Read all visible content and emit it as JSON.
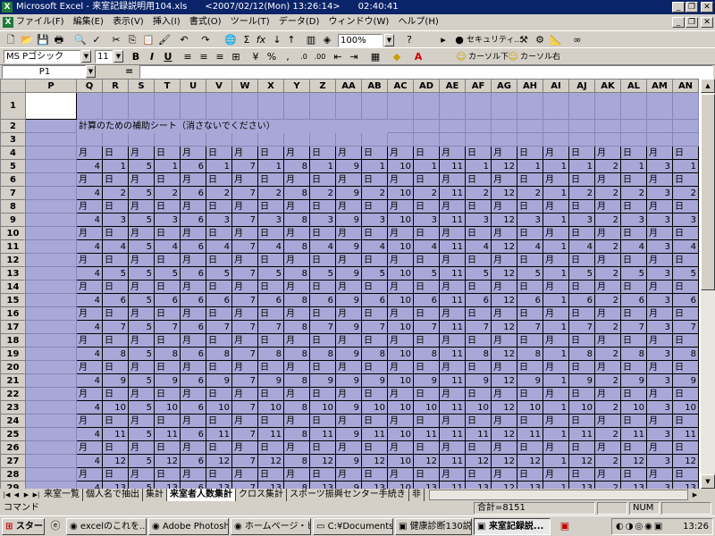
{
  "window": {
    "title": "Microsoft Excel - 来室記録説明用104.xls　　<2007/02/12(Mon) 13:26:14>　　02:40:41",
    "minimize": "_",
    "restore": "❐",
    "close": "✕"
  },
  "menu": [
    "ファイル(F)",
    "編集(E)",
    "表示(V)",
    "挿入(I)",
    "書式(O)",
    "ツール(T)",
    "データ(D)",
    "ウィンドウ(W)",
    "ヘルプ(H)"
  ],
  "toolbar": {
    "zoom": "100%",
    "security_label": "セキュリティ...",
    "font_name": "MS Pゴシック",
    "font_size": "11",
    "bold": "B",
    "italic": "I",
    "underline": "U",
    "cursor_down": "カーソル下",
    "cursor_right": "カーソル右"
  },
  "formula_bar": {
    "name_box": "P1",
    "equals": "=",
    "content": ""
  },
  "sheet": {
    "columns": [
      "P",
      "Q",
      "R",
      "S",
      "T",
      "U",
      "V",
      "W",
      "X",
      "Y",
      "Z",
      "AA",
      "AB",
      "AC",
      "AD",
      "AE",
      "AF",
      "AG",
      "AH",
      "AI",
      "AJ",
      "AK",
      "AL",
      "AM",
      "AN"
    ],
    "row_numbers": [
      "1",
      "2",
      "3",
      "4",
      "5",
      "6",
      "7",
      "8",
      "9",
      "10",
      "11",
      "12",
      "13",
      "14",
      "15",
      "16",
      "17",
      "18",
      "19",
      "20",
      "21",
      "22",
      "23",
      "24",
      "25",
      "26",
      "27",
      "28",
      "29",
      "30"
    ],
    "note": "計算のための補助シート（消さないでください）",
    "label_row": [
      "月",
      "日",
      "月",
      "日",
      "月",
      "日",
      "月",
      "日",
      "月",
      "日",
      "月",
      "日",
      "月",
      "日",
      "月",
      "日",
      "月",
      "日",
      "月",
      "日",
      "月",
      "日",
      "月",
      "日"
    ],
    "value_rows": [
      [
        "4",
        "1",
        "5",
        "1",
        "6",
        "1",
        "7",
        "1",
        "8",
        "1",
        "9",
        "1",
        "10",
        "1",
        "11",
        "1",
        "12",
        "1",
        "1",
        "1",
        "2",
        "1",
        "3",
        "1"
      ],
      [
        "4",
        "2",
        "5",
        "2",
        "6",
        "2",
        "7",
        "2",
        "8",
        "2",
        "9",
        "2",
        "10",
        "2",
        "11",
        "2",
        "12",
        "2",
        "1",
        "2",
        "2",
        "2",
        "3",
        "2"
      ],
      [
        "4",
        "3",
        "5",
        "3",
        "6",
        "3",
        "7",
        "3",
        "8",
        "3",
        "9",
        "3",
        "10",
        "3",
        "11",
        "3",
        "12",
        "3",
        "1",
        "3",
        "2",
        "3",
        "3",
        "3"
      ],
      [
        "4",
        "4",
        "5",
        "4",
        "6",
        "4",
        "7",
        "4",
        "8",
        "4",
        "9",
        "4",
        "10",
        "4",
        "11",
        "4",
        "12",
        "4",
        "1",
        "4",
        "2",
        "4",
        "3",
        "4"
      ],
      [
        "4",
        "5",
        "5",
        "5",
        "6",
        "5",
        "7",
        "5",
        "8",
        "5",
        "9",
        "5",
        "10",
        "5",
        "11",
        "5",
        "12",
        "5",
        "1",
        "5",
        "2",
        "5",
        "3",
        "5"
      ],
      [
        "4",
        "6",
        "5",
        "6",
        "6",
        "6",
        "7",
        "6",
        "8",
        "6",
        "9",
        "6",
        "10",
        "6",
        "11",
        "6",
        "12",
        "6",
        "1",
        "6",
        "2",
        "6",
        "3",
        "6"
      ],
      [
        "4",
        "7",
        "5",
        "7",
        "6",
        "7",
        "7",
        "7",
        "8",
        "7",
        "9",
        "7",
        "10",
        "7",
        "11",
        "7",
        "12",
        "7",
        "1",
        "7",
        "2",
        "7",
        "3",
        "7"
      ],
      [
        "4",
        "8",
        "5",
        "8",
        "6",
        "8",
        "7",
        "8",
        "8",
        "8",
        "9",
        "8",
        "10",
        "8",
        "11",
        "8",
        "12",
        "8",
        "1",
        "8",
        "2",
        "8",
        "3",
        "8"
      ],
      [
        "4",
        "9",
        "5",
        "9",
        "6",
        "9",
        "7",
        "9",
        "8",
        "9",
        "9",
        "9",
        "10",
        "9",
        "11",
        "9",
        "12",
        "9",
        "1",
        "9",
        "2",
        "9",
        "3",
        "9"
      ],
      [
        "4",
        "10",
        "5",
        "10",
        "6",
        "10",
        "7",
        "10",
        "8",
        "10",
        "9",
        "10",
        "10",
        "10",
        "11",
        "10",
        "12",
        "10",
        "1",
        "10",
        "2",
        "10",
        "3",
        "10"
      ],
      [
        "4",
        "11",
        "5",
        "11",
        "6",
        "11",
        "7",
        "11",
        "8",
        "11",
        "9",
        "11",
        "10",
        "11",
        "11",
        "11",
        "12",
        "11",
        "1",
        "11",
        "2",
        "11",
        "3",
        "11"
      ],
      [
        "4",
        "12",
        "5",
        "12",
        "6",
        "12",
        "7",
        "12",
        "8",
        "12",
        "9",
        "12",
        "10",
        "12",
        "11",
        "12",
        "12",
        "12",
        "1",
        "12",
        "2",
        "12",
        "3",
        "12"
      ],
      [
        "4",
        "13",
        "5",
        "13",
        "6",
        "13",
        "7",
        "13",
        "8",
        "13",
        "9",
        "13",
        "10",
        "13",
        "11",
        "13",
        "12",
        "13",
        "1",
        "13",
        "2",
        "13",
        "3",
        "13"
      ]
    ]
  },
  "sheet_tabs": [
    "来室一覧",
    "個人名で抽出",
    "集計",
    "来室者人数集計",
    "クロス集計",
    "スポーツ振興センター手続き",
    "非"
  ],
  "active_tab": "来室者人数集計",
  "status": {
    "mode": "コマンド",
    "sum": "合計=8151",
    "num": "NUM"
  },
  "taskbar": {
    "start": "スタート",
    "tasks": [
      "excelのこれを...",
      "Adobe Photosh...",
      "ホームページ・ビ...",
      "C:¥Documents ...",
      "健康診断130説...",
      "来室記録説..."
    ],
    "active_task": "来室記録説...",
    "clock": "13:26"
  }
}
